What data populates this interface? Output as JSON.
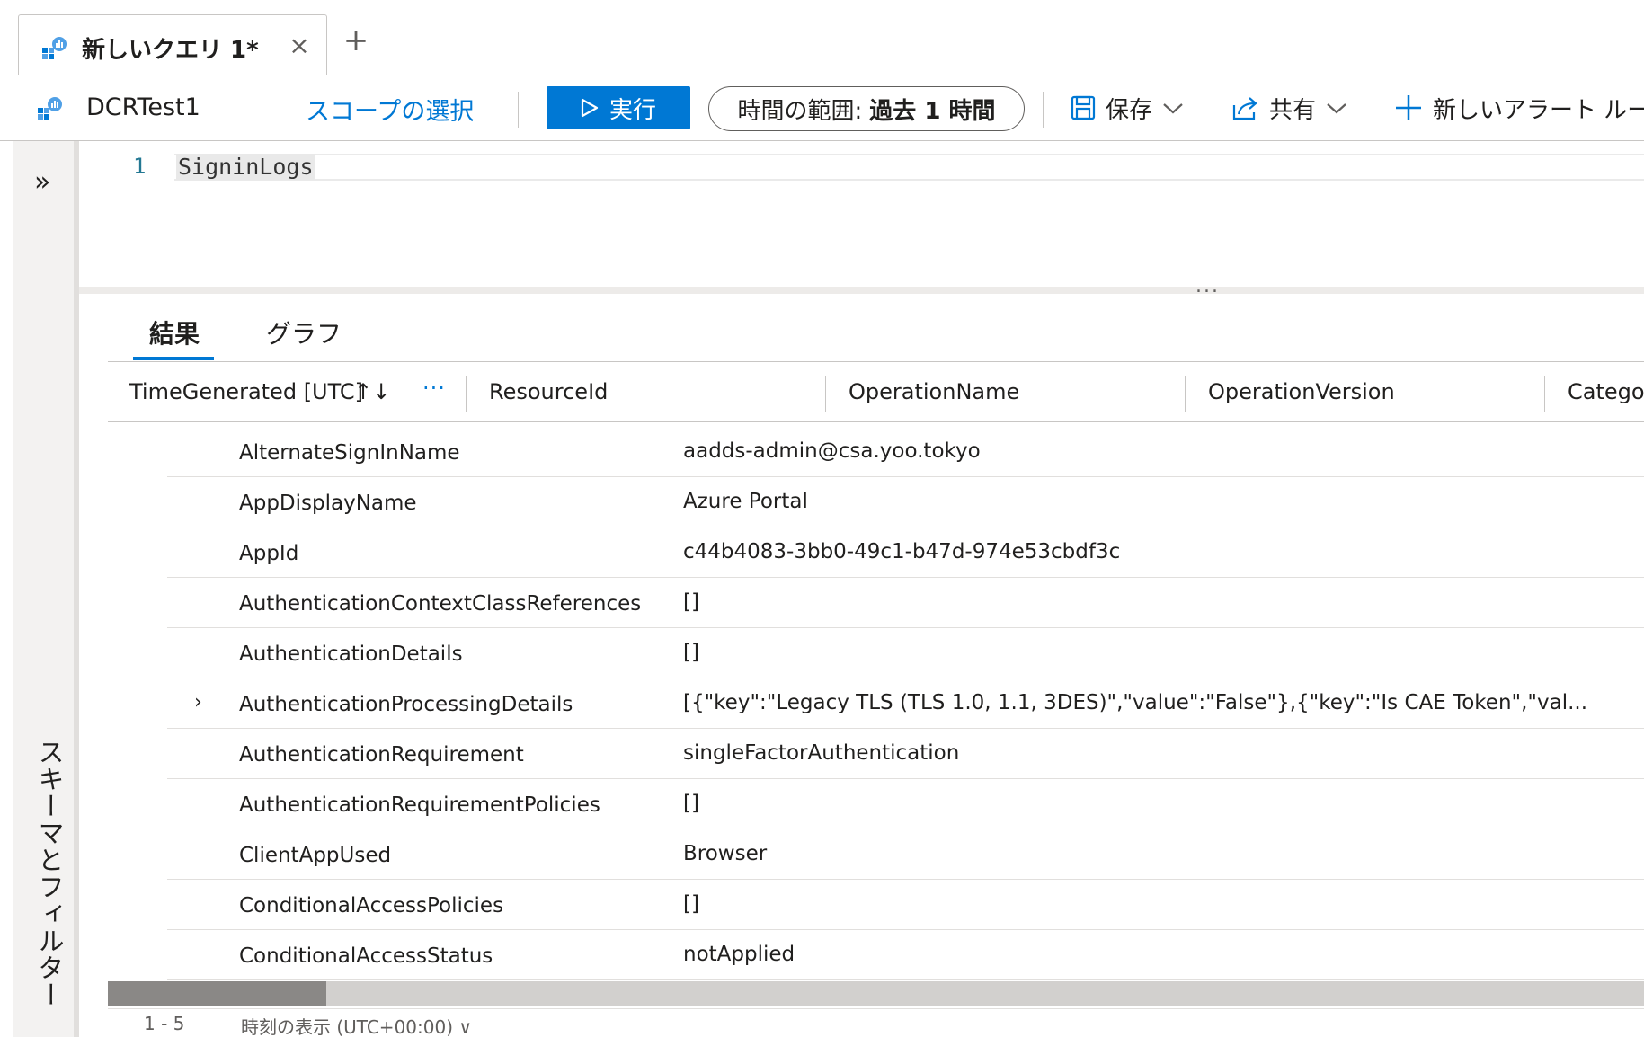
{
  "tab": {
    "title": "新しいクエリ 1*",
    "close": "×",
    "new_tab": "+"
  },
  "toolbar": {
    "workspace": "DCRTest1",
    "scope": "スコープの選択",
    "run": "実行",
    "time_label": "時間の範囲:",
    "time_value": "過去 1 時間",
    "save": "保存",
    "share": "共有",
    "new_alert": "新しいアラート ルール"
  },
  "sidebar": {
    "expand": "»",
    "label": "スキーマとフィルター"
  },
  "editor": {
    "line_number": "1",
    "code": "SigninLogs",
    "splitter": "..."
  },
  "results": {
    "tabs": [
      {
        "label": "結果",
        "active": true
      },
      {
        "label": "グラフ",
        "active": false
      }
    ],
    "columns": [
      "TimeGenerated [UTC]",
      "ResourceId",
      "OperationName",
      "OperationVersion",
      "Categor"
    ],
    "sort_icon": "↑↓",
    "more": "···",
    "rows": [
      {
        "key": "AlternateSignInName",
        "value": "aadds-admin@csa.yoo.tokyo",
        "expandable": false
      },
      {
        "key": "AppDisplayName",
        "value": "Azure Portal",
        "expandable": false
      },
      {
        "key": "AppId",
        "value": "c44b4083-3bb0-49c1-b47d-974e53cbdf3c",
        "expandable": false
      },
      {
        "key": "AuthenticationContextClassReferences",
        "value": "[]",
        "expandable": false
      },
      {
        "key": "AuthenticationDetails",
        "value": "[]",
        "expandable": false
      },
      {
        "key": "AuthenticationProcessingDetails",
        "value": "[{\"key\":\"Legacy TLS (TLS 1.0, 1.1, 3DES)\",\"value\":\"False\"},{\"key\":\"Is CAE Token\",\"val...",
        "expandable": true
      },
      {
        "key": "AuthenticationRequirement",
        "value": "singleFactorAuthentication",
        "expandable": false
      },
      {
        "key": "AuthenticationRequirementPolicies",
        "value": "[]",
        "expandable": false
      },
      {
        "key": "ClientAppUsed",
        "value": "Browser",
        "expandable": false
      },
      {
        "key": "ConditionalAccessPolicies",
        "value": "[]",
        "expandable": false
      },
      {
        "key": "ConditionalAccessStatus",
        "value": "notApplied",
        "expandable": false
      }
    ],
    "expand_chevron": "›"
  },
  "footer": {
    "left": "1 - 5",
    "time_display": "時刻の表示 (UTC+00:00) ∨"
  },
  "colors": {
    "accent": "#0078d4",
    "text": "#201f1e",
    "border": "#c8c6c4"
  }
}
